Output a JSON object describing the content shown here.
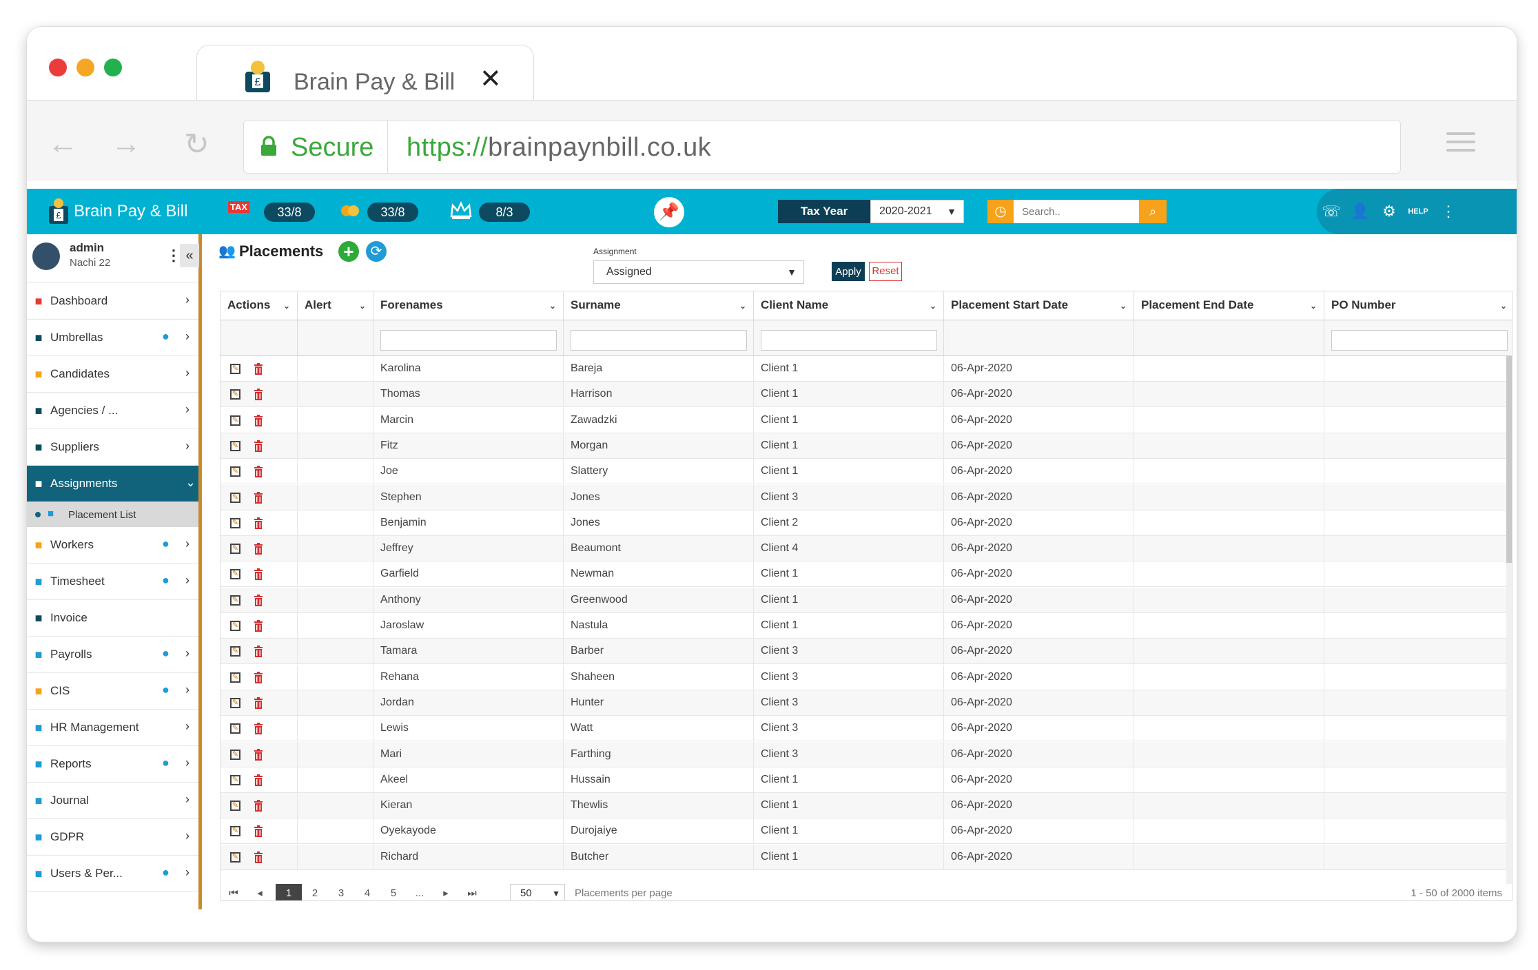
{
  "browser": {
    "tab_title": "Brain Pay & Bill",
    "tab_close": "✕",
    "secure_label": "Secure",
    "url_scheme": "https://",
    "url_host": "brainpaynbill.co.uk",
    "back": "←",
    "forward": "→",
    "reload": "↻"
  },
  "header": {
    "brand": "Brain Pay & Bill",
    "counters": [
      {
        "icon": "TAX",
        "value": "33/8"
      },
      {
        "icon": "coins",
        "value": "33/8"
      },
      {
        "icon": "crown",
        "value": "8/3"
      }
    ],
    "tax_year_label": "Tax Year",
    "tax_year_value": "2020-2021",
    "search_placeholder": "Search..",
    "colors": {
      "bar": "#00b1d2",
      "dark": "#0d3e55",
      "orange": "#f7a21b"
    }
  },
  "user": {
    "name": "admin",
    "sub": "Nachi 22"
  },
  "sidebar": {
    "items": [
      {
        "label": "Dashboard",
        "icon": "bar-chart-icon"
      },
      {
        "label": "Umbrellas",
        "icon": "building-icon",
        "badge": "cloud-upload-icon"
      },
      {
        "label": "Candidates",
        "icon": "people-icon"
      },
      {
        "label": "Agencies / ...",
        "icon": "agency-icon"
      },
      {
        "label": "Suppliers",
        "icon": "supplier-icon"
      },
      {
        "label": "Assignments",
        "icon": "user-icon",
        "active": true
      },
      {
        "label": "Workers",
        "icon": "workers-icon",
        "badge": "add-user-icon"
      },
      {
        "label": "Timesheet",
        "icon": "timesheet-icon",
        "badge": "sync-user-icon"
      },
      {
        "label": "Invoice",
        "icon": "invoice-icon"
      },
      {
        "label": "Payrolls",
        "icon": "payroll-icon",
        "badge": "sync-user-icon"
      },
      {
        "label": "CIS",
        "icon": "cis-icon",
        "badge": "document-icon"
      },
      {
        "label": "HR Management",
        "icon": "hr-icon"
      },
      {
        "label": "Reports",
        "icon": "reports-icon",
        "badge": "bar-chart-icon"
      },
      {
        "label": "Journal",
        "icon": "journal-icon"
      },
      {
        "label": "GDPR",
        "icon": "shield-icon"
      },
      {
        "label": "Users & Per...",
        "icon": "users-icon",
        "badge": "user-icon"
      }
    ],
    "sub_item": "Placement List"
  },
  "page": {
    "title": "Placements",
    "assignment_label": "Assignment",
    "assignment_value": "Assigned",
    "apply": "Apply",
    "reset": "Reset"
  },
  "table": {
    "columns": [
      "Actions",
      "Alert",
      "Forenames",
      "Surname",
      "Client Name",
      "Placement Start Date",
      "Placement End Date",
      "PO Number"
    ],
    "rows": [
      [
        "Karolina",
        "Bareja",
        "Client 1",
        "06-Apr-2020"
      ],
      [
        "Thomas",
        "Harrison",
        "Client 1",
        "06-Apr-2020"
      ],
      [
        "Marcin",
        "Zawadzki",
        "Client 1",
        "06-Apr-2020"
      ],
      [
        "Fitz",
        "Morgan",
        "Client 1",
        "06-Apr-2020"
      ],
      [
        "Joe",
        "Slattery",
        "Client 1",
        "06-Apr-2020"
      ],
      [
        "Stephen",
        "Jones",
        "Client 3",
        "06-Apr-2020"
      ],
      [
        "Benjamin",
        "Jones",
        "Client 2",
        "06-Apr-2020"
      ],
      [
        "Jeffrey",
        "Beaumont",
        "Client 4",
        "06-Apr-2020"
      ],
      [
        "Garfield",
        "Newman",
        "Client 1",
        "06-Apr-2020"
      ],
      [
        "Anthony",
        "Greenwood",
        "Client 1",
        "06-Apr-2020"
      ],
      [
        "Jaroslaw",
        "Nastula",
        "Client 1",
        "06-Apr-2020"
      ],
      [
        "Tamara",
        "Barber",
        "Client 3",
        "06-Apr-2020"
      ],
      [
        "Rehana",
        "Shaheen",
        "Client 3",
        "06-Apr-2020"
      ],
      [
        "Jordan",
        "Hunter",
        "Client 3",
        "06-Apr-2020"
      ],
      [
        "Lewis",
        "Watt",
        "Client 3",
        "06-Apr-2020"
      ],
      [
        "Mari",
        "Farthing",
        "Client 3",
        "06-Apr-2020"
      ],
      [
        "Akeel",
        "Hussain",
        "Client 1",
        "06-Apr-2020"
      ],
      [
        "Kieran",
        "Thewlis",
        "Client 1",
        "06-Apr-2020"
      ],
      [
        "Oyekayode",
        "Durojaiye",
        "Client 1",
        "06-Apr-2020"
      ],
      [
        "Richard",
        "Butcher",
        "Client 1",
        "06-Apr-2020"
      ]
    ]
  },
  "pager": {
    "pages": [
      "1",
      "2",
      "3",
      "4",
      "5",
      "..."
    ],
    "current": "1",
    "per_page": "50",
    "per_page_label": "Placements per page",
    "summary": "1 - 50 of 2000 items"
  }
}
